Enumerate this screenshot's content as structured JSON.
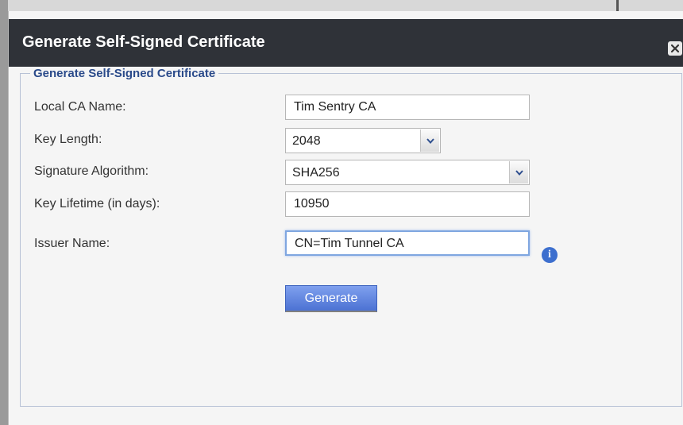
{
  "dialog": {
    "title": "Generate Self-Signed Certificate",
    "close_icon": "close-icon"
  },
  "form": {
    "legend": "Generate Self-Signed Certificate",
    "local_ca_name": {
      "label": "Local CA Name:",
      "value": "Tim Sentry CA"
    },
    "key_length": {
      "label": "Key Length:",
      "value": "2048",
      "icon": "chevron-down-icon"
    },
    "signature_algorithm": {
      "label": "Signature Algorithm:",
      "value": "SHA256",
      "icon": "chevron-down-icon"
    },
    "key_lifetime": {
      "label": "Key Lifetime (in days):",
      "value": "10950"
    },
    "issuer_name": {
      "label": "Issuer Name:",
      "value": "CN=Tim Tunnel CA",
      "info_icon": "info-icon",
      "info_glyph": "i"
    },
    "generate_label": "Generate"
  },
  "colors": {
    "titlebar": "#2f3238",
    "legend_text": "#2a4a8a",
    "button": "#5a7edb",
    "info_icon": "#3d6fce"
  }
}
